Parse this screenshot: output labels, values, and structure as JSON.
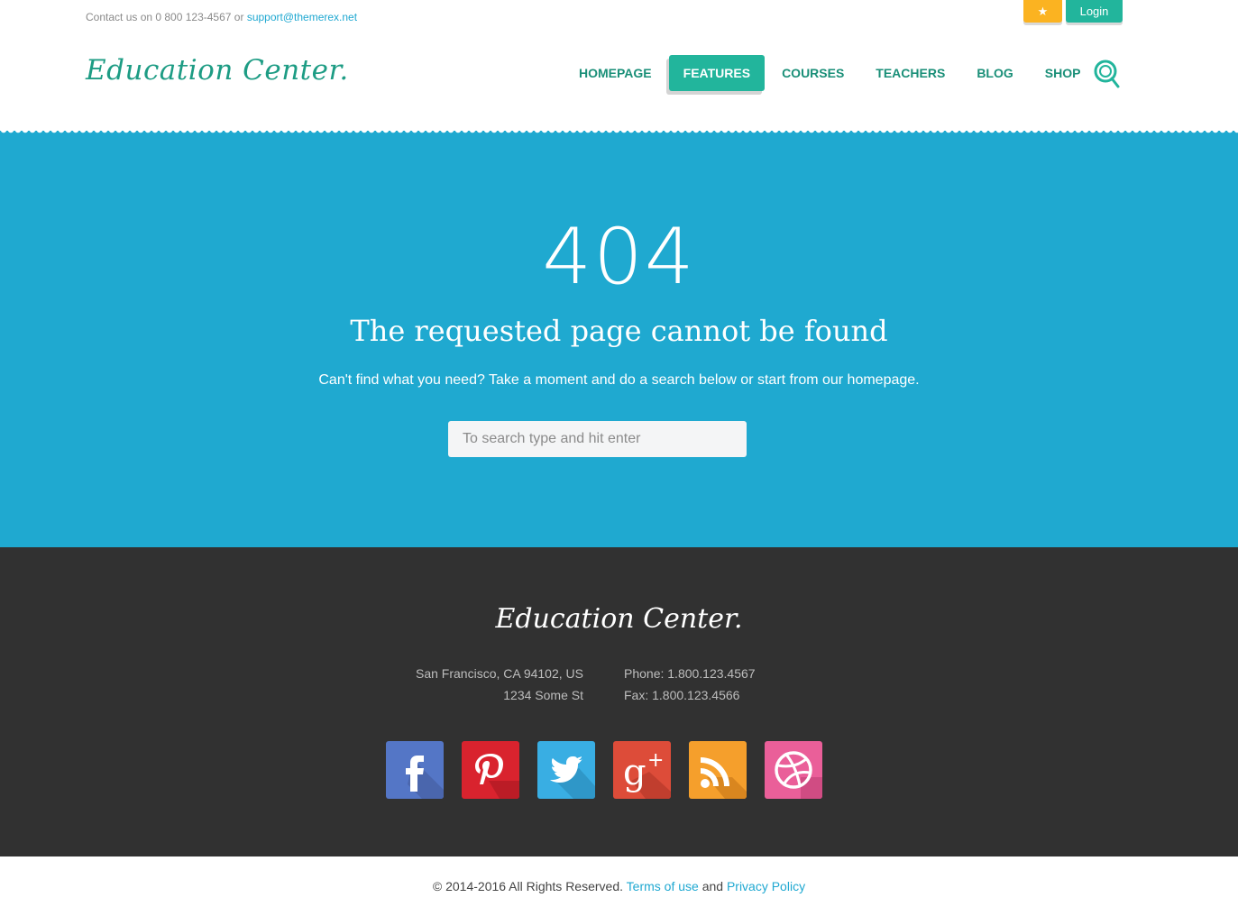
{
  "topbar": {
    "contact_prefix": "Contact us on 0 800 123-4567 or",
    "contact_email": "support@themerex.net",
    "favorites_icon": "star-icon",
    "login_label": "Login"
  },
  "header": {
    "logo": "Education Center.",
    "nav": [
      {
        "label": "HOMEPAGE"
      },
      {
        "label": "FEATURES",
        "active": true
      },
      {
        "label": "COURSES"
      },
      {
        "label": "TEACHERS"
      },
      {
        "label": "BLOG"
      },
      {
        "label": "SHOP"
      }
    ],
    "search_icon": "search-icon"
  },
  "hero": {
    "code": "404",
    "title": "The requested page cannot be found",
    "text": "Can't find what you need? Take a moment and do a search below or start from our homepage.",
    "search_placeholder": "To search type and hit enter"
  },
  "footer": {
    "logo": "Education Center.",
    "address_line1": "San Francisco, CA 94102, US",
    "address_line2": "1234 Some St",
    "phone": "Phone: 1.800.123.4567",
    "fax": "Fax: 1.800.123.4566",
    "socials": [
      {
        "name": "facebook",
        "color": "#5476c6"
      },
      {
        "name": "pinterest",
        "color": "#d9232e"
      },
      {
        "name": "twitter",
        "color": "#39aee3"
      },
      {
        "name": "google-plus",
        "color": "#dd4c39"
      },
      {
        "name": "rss",
        "color": "#f59f2c"
      },
      {
        "name": "dribbble",
        "color": "#ea5f99"
      }
    ]
  },
  "bottom": {
    "copyright": "© 2014-2016 All Rights Reserved.",
    "terms": "Terms of use",
    "and": "and",
    "privacy": "Privacy Policy"
  },
  "colors": {
    "accent_green": "#22b59c",
    "hero_blue": "#1fa9d0",
    "footer_dark": "#313131",
    "favorites_yellow": "#fbb321",
    "link_blue": "#1fa8d1"
  }
}
